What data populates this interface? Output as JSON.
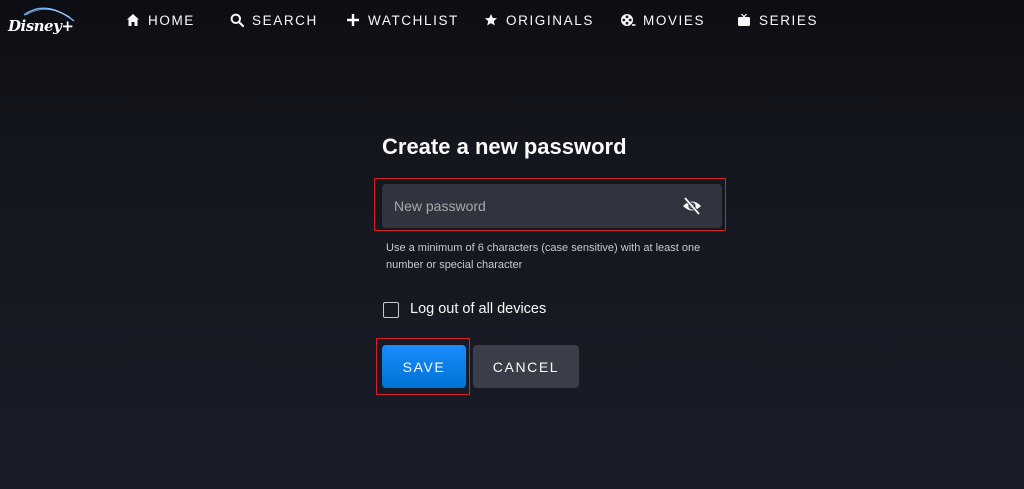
{
  "brand": {
    "logo_text": "Disney+",
    "colors": {
      "background": "#1a1d29",
      "primary_button": "#0072d2",
      "secondary_button": "#3b3e49",
      "input_background": "#31343e",
      "highlight": "#d61f26"
    }
  },
  "nav": {
    "items": [
      {
        "label": "HOME",
        "icon": "home-icon"
      },
      {
        "label": "SEARCH",
        "icon": "search-icon"
      },
      {
        "label": "WATCHLIST",
        "icon": "plus-icon"
      },
      {
        "label": "ORIGINALS",
        "icon": "star-icon"
      },
      {
        "label": "MOVIES",
        "icon": "film-reel-icon"
      },
      {
        "label": "SERIES",
        "icon": "tv-icon"
      }
    ]
  },
  "form": {
    "title": "Create a new password",
    "password": {
      "placeholder": "New password",
      "value": "",
      "toggle_icon": "eye-off-icon"
    },
    "hint": "Use a minimum of 6 characters (case sensitive) with at least one number or special character",
    "logout_all": {
      "label": "Log out of all devices",
      "checked": false
    },
    "save_label": "SAVE",
    "cancel_label": "CANCEL"
  }
}
